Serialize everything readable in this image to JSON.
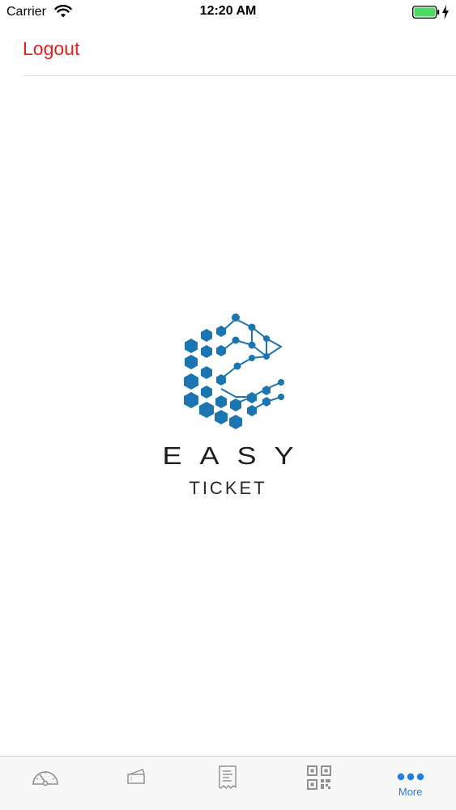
{
  "status_bar": {
    "carrier": "Carrier",
    "time": "12:20 AM"
  },
  "header": {
    "logout_label": "Logout"
  },
  "logo": {
    "brand": "EASY",
    "subtitle": "TICKET",
    "mark_color": "#1a75b0"
  },
  "tab_bar": {
    "tabs": [
      {
        "icon": "speedometer-icon",
        "label": ""
      },
      {
        "icon": "tickets-icon",
        "label": ""
      },
      {
        "icon": "receipt-icon",
        "label": ""
      },
      {
        "icon": "qr-code-icon",
        "label": ""
      },
      {
        "icon": "more-icon",
        "label": "More",
        "active": true
      }
    ],
    "active_color": "#1e7fe0",
    "inactive_color": "#8e8e93"
  },
  "colors": {
    "logout": "#e0201e",
    "battery": "#4cd964"
  }
}
